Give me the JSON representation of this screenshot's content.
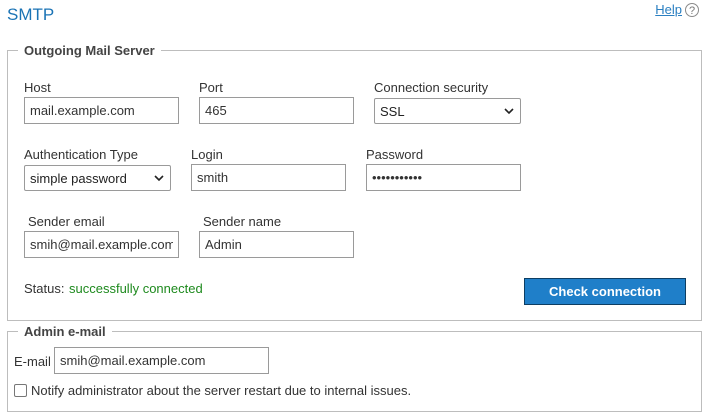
{
  "page": {
    "title": "SMTP",
    "help_label": "Help",
    "help_icon": "?"
  },
  "outgoing": {
    "legend": "Outgoing Mail Server",
    "host": {
      "label": "Host",
      "value": "mail.example.com"
    },
    "port": {
      "label": "Port",
      "value": "465"
    },
    "security": {
      "label": "Connection security",
      "value": "SSL"
    },
    "auth": {
      "label": "Authentication Type",
      "value": "simple password"
    },
    "login": {
      "label": "Login",
      "value": "smith"
    },
    "password": {
      "label": "Password",
      "value": "•••••••••••"
    },
    "sender_email": {
      "label": "Sender email",
      "value": "smih@mail.example.com"
    },
    "sender_name": {
      "label": "Sender name",
      "value": "Admin"
    },
    "status": {
      "label": "Status:",
      "value": "successfully connected"
    },
    "check_button": "Check connection"
  },
  "admin": {
    "legend": "Admin e-mail",
    "email": {
      "label": "E-mail",
      "value": "smih@mail.example.com"
    },
    "notify": {
      "label": "Notify administrator about the server restart due to internal issues.",
      "checked": false
    }
  },
  "colors": {
    "accent": "#1f7fc9",
    "title": "#1a73b5",
    "success": "#1e8a1e"
  }
}
